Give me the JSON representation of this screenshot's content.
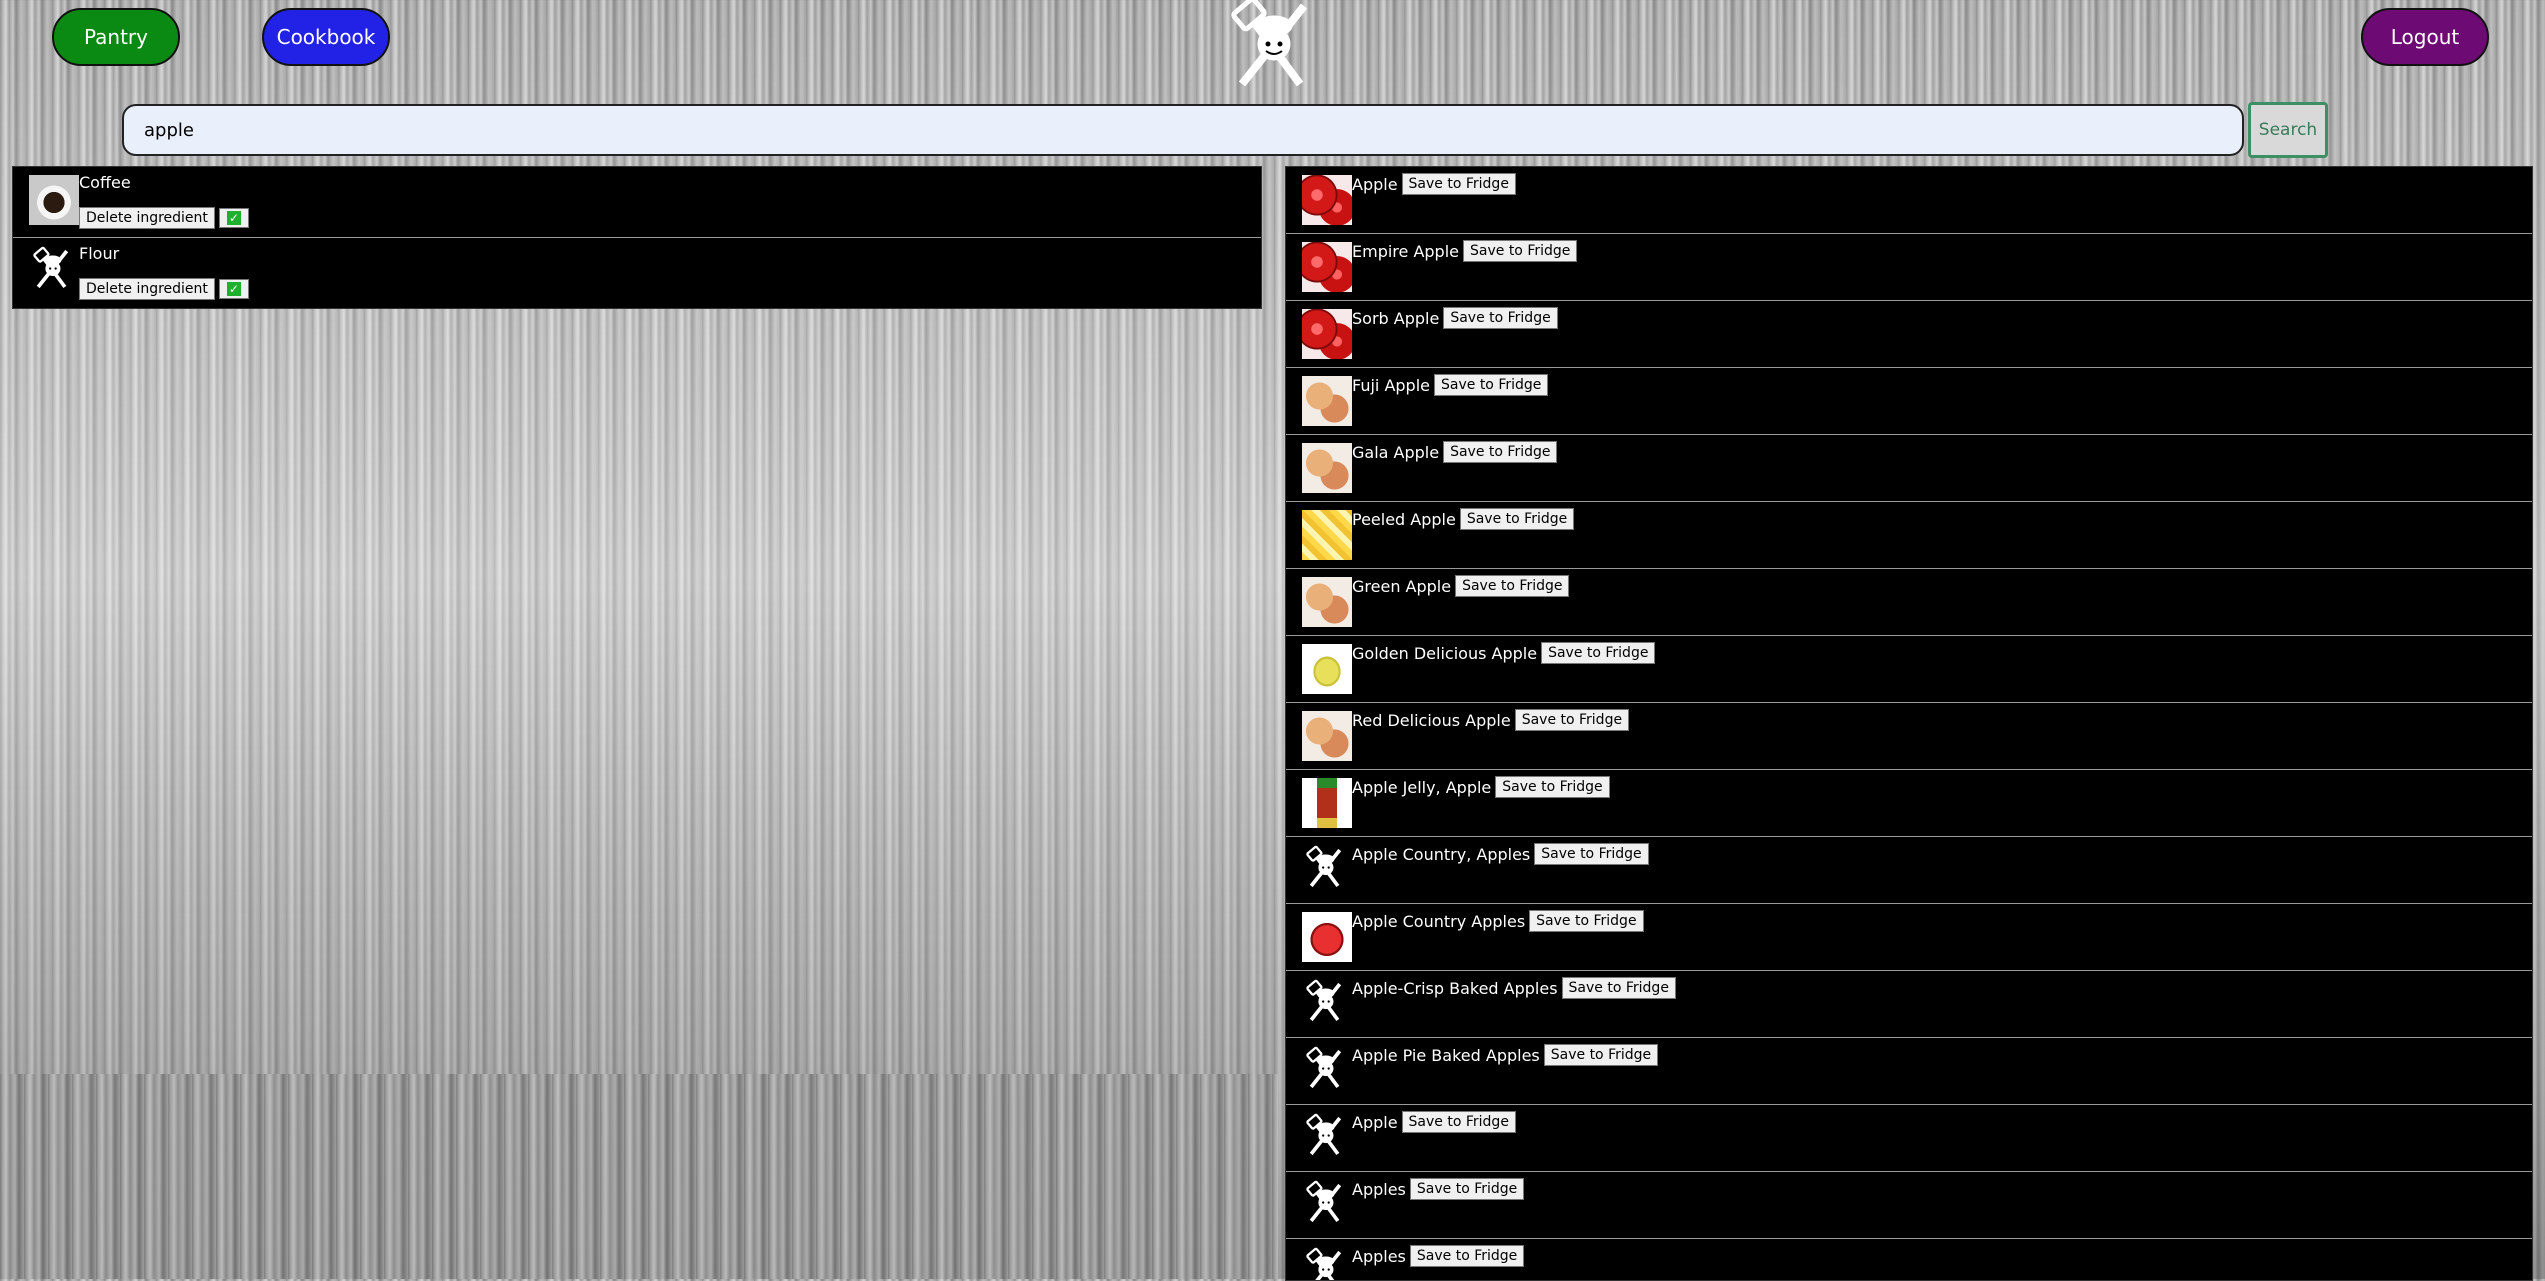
{
  "nav": {
    "pantry_label": "Pantry",
    "cookbook_label": "Cookbook",
    "logout_label": "Logout",
    "colors": {
      "pantry": "#0a8a12",
      "cookbook": "#2222e6",
      "logout": "#6e0a73"
    }
  },
  "logo": {
    "icon": "chef-utensils-logo-icon"
  },
  "search": {
    "value": "apple",
    "button_label": "Search"
  },
  "pantry": {
    "items": [
      {
        "name": "Coffee",
        "delete_label": "Delete ingredient",
        "checked": true,
        "thumb": "coffee-cup-icon"
      },
      {
        "name": "Flour",
        "delete_label": "Delete ingredient",
        "checked": true,
        "thumb": "chef-utensils-logo-icon"
      }
    ]
  },
  "results": {
    "save_label": "Save to Fridge",
    "items": [
      {
        "name": "Apple",
        "thumb": "red"
      },
      {
        "name": "Empire Apple",
        "thumb": "red"
      },
      {
        "name": "Sorb Apple",
        "thumb": "red"
      },
      {
        "name": "Fuji Apple",
        "thumb": "gala"
      },
      {
        "name": "Gala Apple",
        "thumb": "gala"
      },
      {
        "name": "Peeled Apple",
        "thumb": "peeled"
      },
      {
        "name": "Green Apple",
        "thumb": "gala"
      },
      {
        "name": "Golden Delicious Apple",
        "thumb": "golden"
      },
      {
        "name": "Red Delicious Apple",
        "thumb": "gala"
      },
      {
        "name": "Apple Jelly, Apple",
        "thumb": "jelly"
      },
      {
        "name": "Apple Country, Apples",
        "thumb": "logo"
      },
      {
        "name": "Apple Country Apples",
        "thumb": "country"
      },
      {
        "name": "Apple-Crisp Baked Apples",
        "thumb": "logo"
      },
      {
        "name": "Apple Pie Baked Apples",
        "thumb": "logo"
      },
      {
        "name": "Apple",
        "thumb": "logo"
      },
      {
        "name": "Apples",
        "thumb": "logo"
      },
      {
        "name": "Apples",
        "thumb": "logo"
      }
    ]
  }
}
